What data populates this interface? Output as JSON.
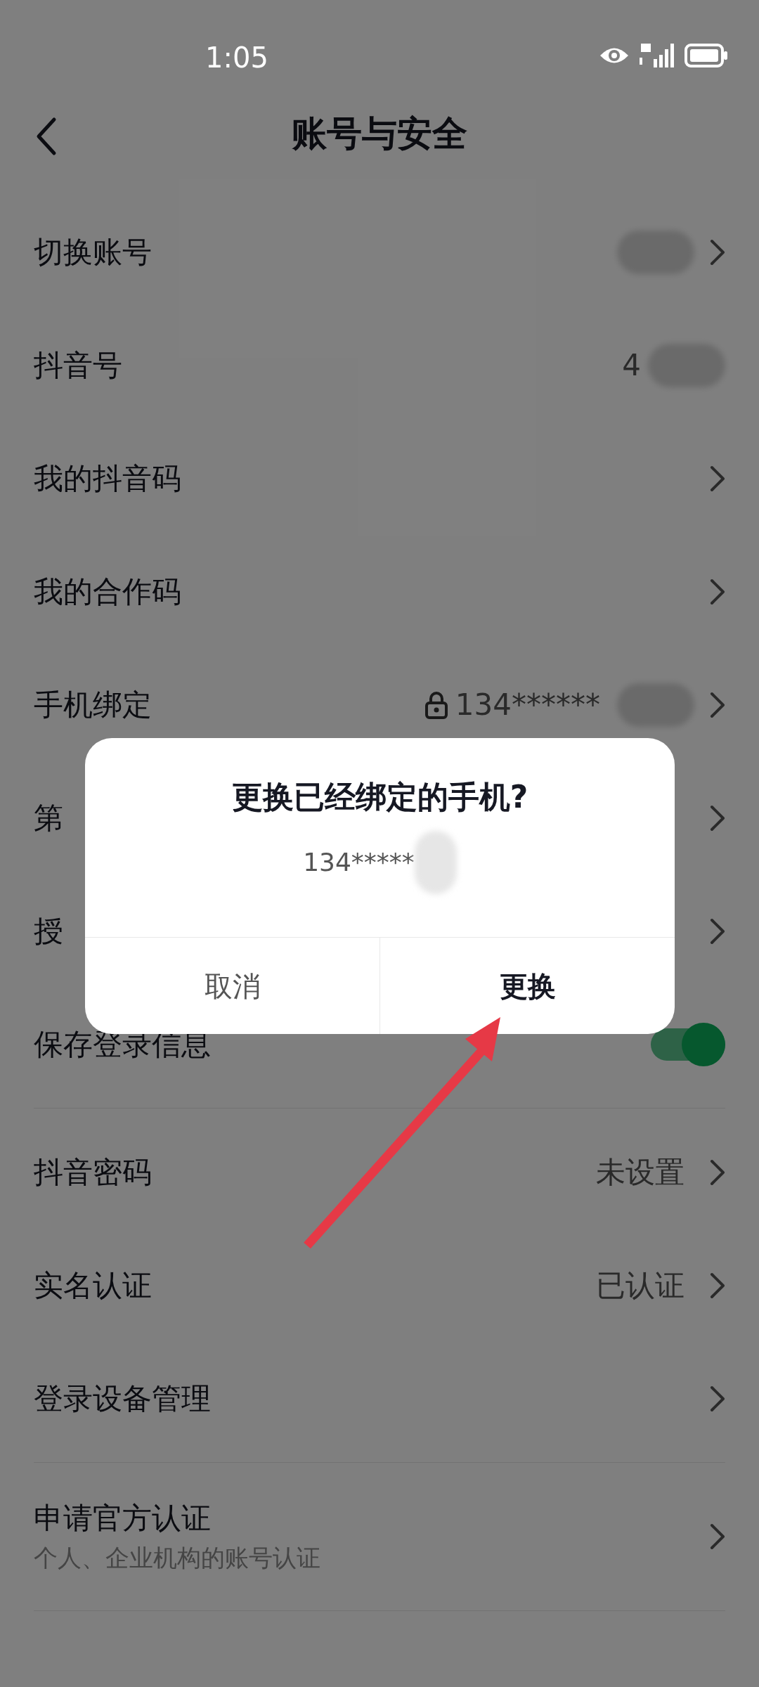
{
  "status_bar": {
    "time": "1:05"
  },
  "header": {
    "title": "账号与安全"
  },
  "sections": [
    {
      "rows": [
        {
          "kind": "link",
          "label": "切换账号",
          "redacted": true
        },
        {
          "kind": "plain",
          "label": "抖音号",
          "value": "4",
          "redacted": true
        },
        {
          "kind": "link",
          "label": "我的抖音码"
        },
        {
          "kind": "link",
          "label": "我的合作码"
        },
        {
          "kind": "link",
          "label": "手机绑定",
          "value": "134******",
          "locked": true,
          "redacted": true
        },
        {
          "kind": "link",
          "label": "第"
        },
        {
          "kind": "link",
          "label": "授"
        },
        {
          "kind": "toggle",
          "label": "保存登录信息",
          "on": true
        }
      ]
    },
    {
      "rows": [
        {
          "kind": "link",
          "label": "抖音密码",
          "value": "未设置"
        },
        {
          "kind": "link",
          "label": "实名认证",
          "value": "已认证"
        },
        {
          "kind": "link",
          "label": "登录设备管理"
        }
      ]
    },
    {
      "rows": [
        {
          "kind": "link",
          "label": "申请官方认证",
          "subtitle": "个人、企业机构的账号认证"
        }
      ]
    }
  ],
  "dialog": {
    "title": "更换已经绑定的手机?",
    "message": "134*****",
    "redacted": true,
    "buttons": [
      {
        "label": "取消",
        "primary": false
      },
      {
        "label": "更换",
        "primary": true
      }
    ]
  }
}
